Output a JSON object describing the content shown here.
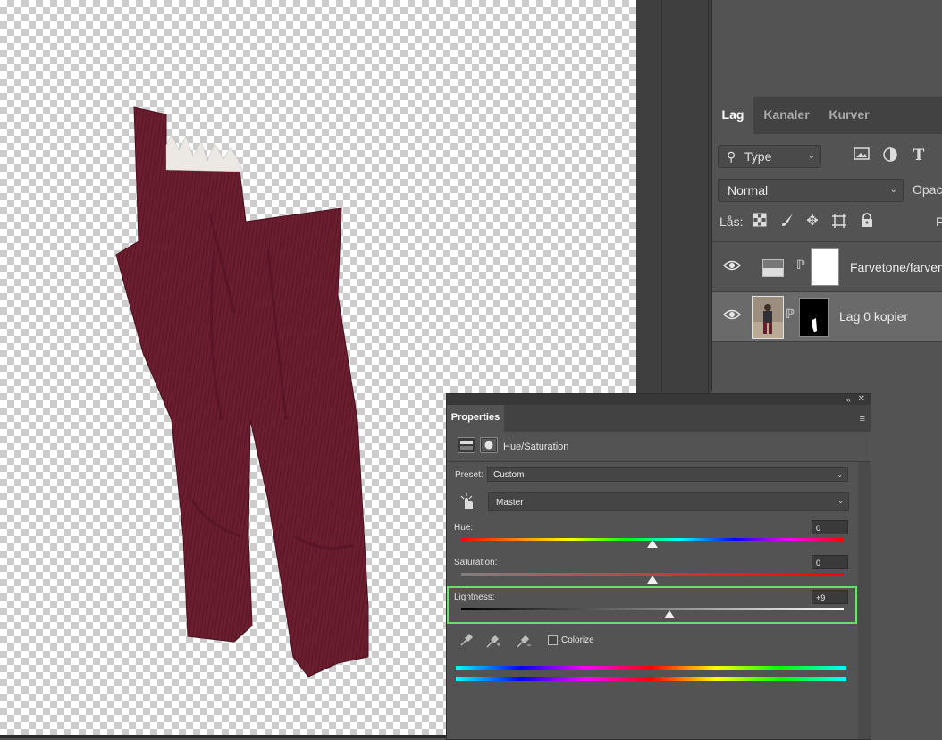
{
  "colors": {
    "canvas_checker": "#cccccc",
    "panel_bg": "#535353",
    "selected_layer": "#6a6a6a",
    "highlight": "#67e06a",
    "pants": "#6b1e2f"
  },
  "layers_panel": {
    "tabs": [
      {
        "label": "Lag",
        "active": true
      },
      {
        "label": "Kanaler",
        "active": false
      },
      {
        "label": "Kurver",
        "active": false
      }
    ],
    "filter": {
      "label": "Type",
      "icon": "search-icon"
    },
    "filter_icons": [
      "image-filter-icon",
      "adjustment-filter-icon",
      "type-filter-icon"
    ],
    "blend_mode": "Normal",
    "opacity_label": "Opacity",
    "lock_label": "Lås:",
    "lock_icons": [
      "lock-transparent-pixels-icon",
      "lock-image-pixels-icon",
      "lock-position-icon",
      "lock-artboard-icon",
      "lock-all-icon"
    ],
    "fill_label": "F",
    "layers": [
      {
        "name": "Farvetone/farvem",
        "visible": true,
        "selected": false,
        "type": "adjustment"
      },
      {
        "name": "Lag 0 kopier",
        "visible": true,
        "selected": true,
        "type": "pixel"
      }
    ]
  },
  "properties": {
    "tab_label": "Properties",
    "adjustment_title": "Hue/Saturation",
    "preset_label": "Preset:",
    "preset_value": "Custom",
    "channel_value": "Master",
    "hue": {
      "label": "Hue:",
      "value": "0",
      "position": 0.5
    },
    "saturation": {
      "label": "Saturation:",
      "value": "0",
      "position": 0.5
    },
    "lightness": {
      "label": "Lightness:",
      "value": "+9",
      "position": 0.545
    },
    "colorize_label": "Colorize",
    "colorize_checked": false,
    "tools": [
      "eyedropper-icon",
      "eyedropper-plus-icon",
      "eyedropper-minus-icon"
    ]
  }
}
